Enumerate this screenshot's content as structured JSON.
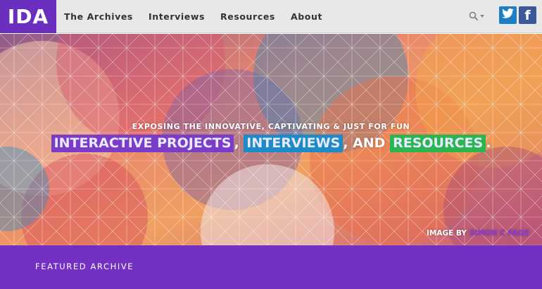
{
  "header": {
    "logo_text": "IDA",
    "nav": [
      {
        "label": "The Archives"
      },
      {
        "label": "Interviews"
      },
      {
        "label": "Resources"
      },
      {
        "label": "About"
      }
    ],
    "search_icon": "search-icon",
    "social": {
      "twitter_icon": "twitter-icon",
      "facebook_icon": "facebook-icon",
      "facebook_glyph": "f"
    }
  },
  "hero": {
    "tagline": "EXPOSING THE INNOVATIVE, CAPTIVATING & JUST FOR FUN",
    "highlight_1": "INTERACTIVE PROJECTS",
    "sep_1": ",",
    "highlight_2": "INTERVIEWS",
    "sep_2": ", AND",
    "highlight_3": "RESOURCES",
    "end": ".",
    "credit_prefix": "IMAGE BY",
    "credit_name": "SIMON C PAGE"
  },
  "featured": {
    "label": "FEATURED ARCHIVE"
  },
  "colors": {
    "brand_purple": "#6b2fbf",
    "featured_purple": "#7330c2",
    "twitter_blue": "#1a7fc4",
    "facebook_blue": "#3b5998",
    "highlight_purple": "#7b3cc7",
    "highlight_blue": "#1e8bc9",
    "highlight_green": "#29b54f"
  }
}
